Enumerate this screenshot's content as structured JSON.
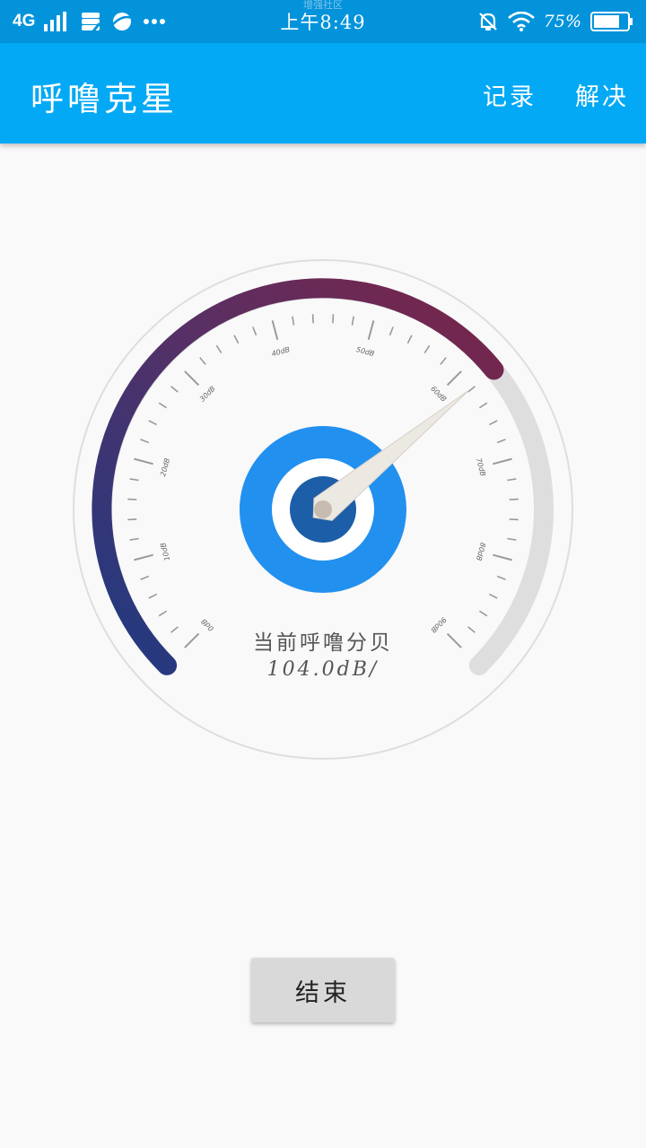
{
  "status_bar": {
    "network": "4G",
    "watermark": "增强社区",
    "time": "上午8:49",
    "battery": "75%"
  },
  "app_bar": {
    "title": "呼噜克星",
    "actions": {
      "record": "记录",
      "solve": "解决"
    }
  },
  "gauge": {
    "label": "当前呼噜分贝",
    "value_text": "104.0dB/",
    "tick_labels": [
      "0dB",
      "10dB",
      "20dB",
      "30dB",
      "40dB",
      "50dB",
      "60dB",
      "70dB",
      "80dB",
      "90dB"
    ],
    "level_fraction": 0.688,
    "colors": {
      "arc_start": "#1f3a82",
      "arc_mid": "#573065",
      "arc_end": "#7a2448",
      "arc_track": "#dedede",
      "hub_outer": "#2290ef",
      "hub_white": "#ffffff",
      "hub_inner": "#1c5ea7",
      "needle": "#ece8e2",
      "needle_pivot": "#c6bcb0"
    }
  },
  "end_button": {
    "label": "结束"
  }
}
